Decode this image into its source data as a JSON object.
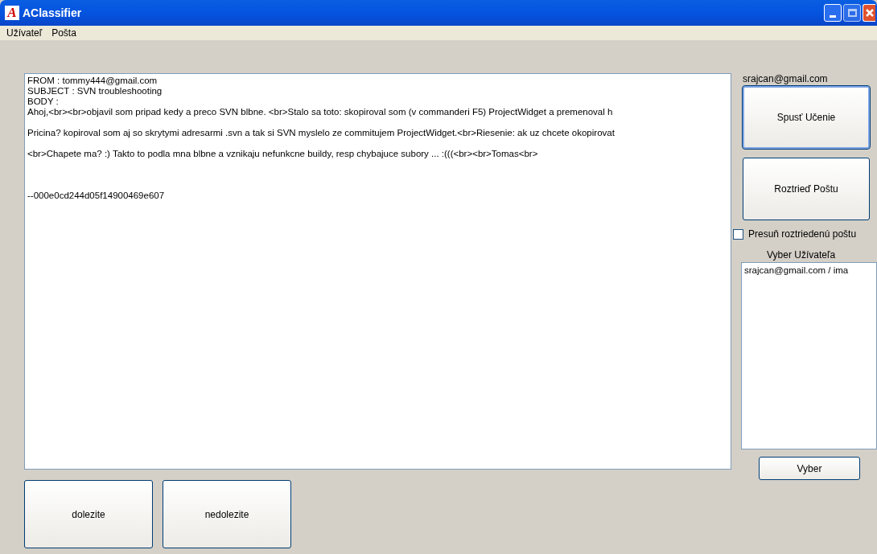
{
  "window": {
    "title": "AClassifier",
    "logo": "A"
  },
  "menu": [
    {
      "label": "Užívateľ"
    },
    {
      "label": "Pošta"
    }
  ],
  "message": {
    "blocks": [
      {
        "kind": "header",
        "lines": [
          "FROM : tommy444@gmail.com",
          "SUBJECT : SVN troubleshooting",
          "BODY :",
          "Ahoj,<br><br>objavil som pripad kedy a preco SVN blbne. <br>Stalo sa toto: skopiroval som (v commanderi F5) ProjectWidget a premenoval h"
        ]
      },
      {
        "kind": "paragraph",
        "lines": [
          "Pricina? kopiroval som aj so skrytymi adresarmi .svn a tak si SVN myslelo ze commitujem ProjectWidget.<br>Riesenie: ak uz chcete okopirovat"
        ]
      },
      {
        "kind": "paragraph",
        "lines": [
          "<br>Chapete ma? :) Takto to podla mna blbne a vznikaju nefunkcne buildy, resp chybajuce subory ... :(((<br><br>Tomas<br>"
        ]
      },
      {
        "kind": "signature",
        "lines": [
          "--000e0cd244d05f14900469e607"
        ]
      }
    ]
  },
  "bottom_buttons": [
    {
      "label": "dolezite"
    },
    {
      "label": "nedolezite"
    }
  ],
  "side": {
    "account": "srajcan@gmail.com",
    "buttons": [
      {
        "label": "Spusť Učenie",
        "focused": true
      },
      {
        "label": "Roztrieď Poštu",
        "focused": false
      }
    ],
    "move_checkbox": {
      "label": "Presuň roztriedenú poštu",
      "checked": false
    },
    "users_label": "Vyber Užívateľa",
    "users": [
      {
        "label": "srajcan@gmail.com / ima",
        "selected": false
      }
    ],
    "select_button": "Vyber"
  }
}
